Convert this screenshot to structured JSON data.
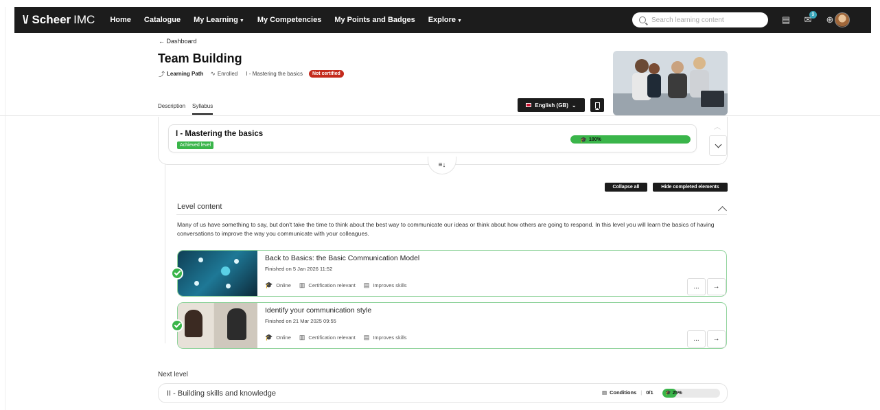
{
  "nav": {
    "brand": {
      "mark": "\\/",
      "name": "Scheer",
      "suffix": "IMC"
    },
    "links": [
      {
        "label": "Home"
      },
      {
        "label": "Catalogue"
      },
      {
        "label": "My Learning",
        "dropdown": true
      },
      {
        "label": "My Competencies"
      },
      {
        "label": "My Points and Badges"
      },
      {
        "label": "Explore",
        "dropdown": true
      }
    ],
    "search_placeholder": "Search learning content",
    "icons": [
      "catalog-icon",
      "inbox-icon",
      "globe-icon",
      "user-avatar"
    ],
    "inbox_count": "9"
  },
  "header": {
    "back_label": "← Dashboard",
    "title": "Team Building",
    "type_label": "Learning Path",
    "status_label": "Enrolled",
    "current_level": "I - Mastering the basics",
    "cert_badge": "Not certified",
    "tabs": [
      "Description",
      "Syllabus"
    ],
    "active_tab": "Syllabus",
    "language_button": "English (GB)"
  },
  "level": {
    "title": "I - Mastering the basics",
    "badge": "Achieved level",
    "progress": 100,
    "progress_label": "100%"
  },
  "actions": {
    "collapse_all": "Collapse all",
    "hide_completed": "Hide completed elements"
  },
  "content": {
    "heading": "Level content",
    "description": "Many of us have something to say, but don't take the time to think about the best way to communicate our ideas or think about how others are going to respond. In this level you will learn the basics of having conversations to improve the way you communicate with your colleagues.",
    "items": [
      {
        "title": "Back to Basics: the Basic Communication Model",
        "finished": "Finished on 5 Jan 2026 11:52",
        "tags": [
          "Online",
          "Certification relevant",
          "Improves skills"
        ]
      },
      {
        "title": "Identify your communication style",
        "finished": "Finished on 21 Mar 2025 09:55",
        "tags": [
          "Online",
          "Certification relevant",
          "Improves skills"
        ]
      }
    ],
    "more_label": "...",
    "open_label": "→"
  },
  "next_level": {
    "label": "Next level",
    "title": "II - Building skills and knowledge",
    "conditions_label": "Conditions",
    "conditions_value": "0/1",
    "progress": 25,
    "progress_label": "25%"
  },
  "colors": {
    "nav_bg": "#1c1c1c",
    "accent_green": "#3ab54a",
    "badge_red": "#c42a1c",
    "item_border": "#8fd39b"
  }
}
